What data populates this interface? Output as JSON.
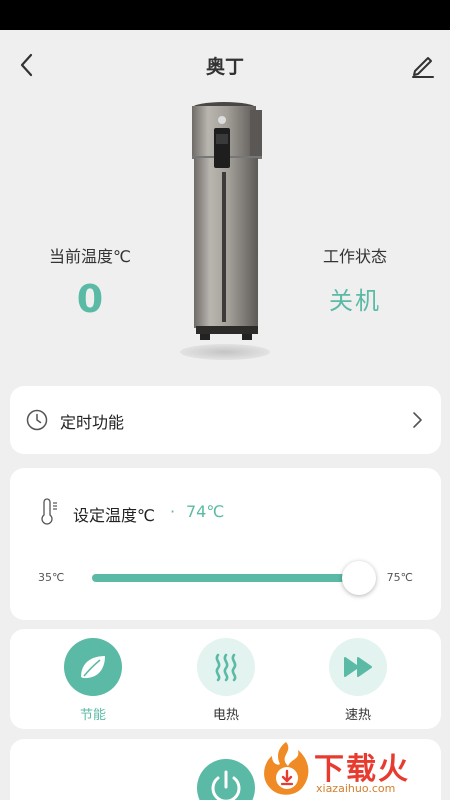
{
  "header": {
    "title": "奥丁",
    "back_icon": "chevron-left-icon",
    "edit_icon": "pencil-icon"
  },
  "status": {
    "current_temp_label": "当前温度℃",
    "current_temp_value": "0",
    "work_state_label": "工作状态",
    "work_state_value": "关机"
  },
  "timer": {
    "label": "定时功能",
    "icon": "clock-icon"
  },
  "temperature": {
    "title": "设定温度℃",
    "separator": "·",
    "value": "74℃",
    "min_label": "35℃",
    "max_label": "75℃",
    "min": 35,
    "max": 75,
    "current": 74
  },
  "modes": [
    {
      "label": "节能",
      "icon": "leaf-icon",
      "active": true
    },
    {
      "label": "电热",
      "icon": "heat-waves-icon",
      "active": false
    },
    {
      "label": "速热",
      "icon": "fast-forward-icon",
      "active": false
    }
  ],
  "power": {
    "icon": "power-icon"
  },
  "watermark": {
    "text": "下载火",
    "sub": "xiazaihuo.com"
  },
  "colors": {
    "accent": "#5bbaa5",
    "background": "#efefef",
    "card": "#ffffff"
  }
}
